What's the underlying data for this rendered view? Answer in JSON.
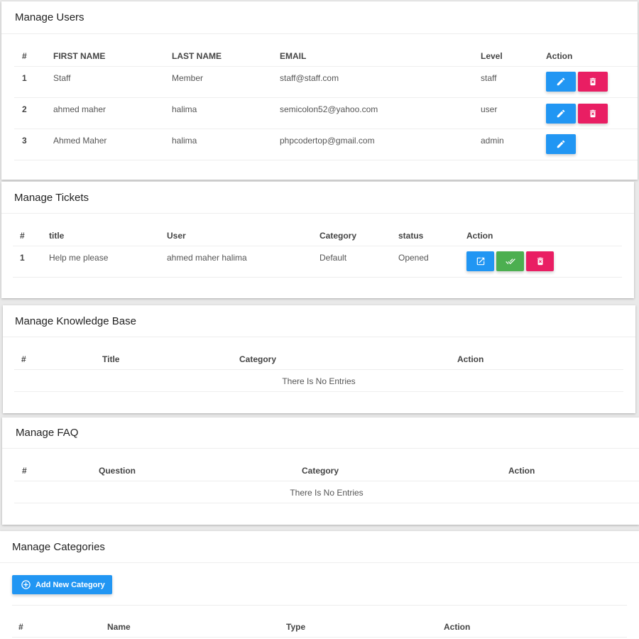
{
  "users": {
    "title": "Manage Users",
    "headers": [
      "#",
      "FIRST NAME",
      "LAST NAME",
      "EMAIL",
      "Level",
      "Action"
    ],
    "rows": [
      {
        "idx": "1",
        "first": "Staff",
        "last": "Member",
        "email": "staff@staff.com",
        "level": "staff"
      },
      {
        "idx": "2",
        "first": "ahmed maher",
        "last": "halima",
        "email": "semicolon52@yahoo.com",
        "level": "user"
      },
      {
        "idx": "3",
        "first": "Ahmed Maher",
        "last": "halima",
        "email": "phpcodertop@gmail.com",
        "level": "admin"
      }
    ]
  },
  "tickets": {
    "title": "Manage Tickets",
    "headers": [
      "#",
      "title",
      "User",
      "Category",
      "status",
      "Action"
    ],
    "rows": [
      {
        "idx": "1",
        "title": "Help me please",
        "user": "ahmed maher halima",
        "category": "Default",
        "status": "Opened"
      }
    ]
  },
  "kb": {
    "title": "Manage Knowledge Base",
    "headers": [
      "#",
      "Title",
      "Category",
      "Action"
    ],
    "empty": "There Is No Entries"
  },
  "faq": {
    "title": "Manage FAQ",
    "headers": [
      "#",
      "Question",
      "Category",
      "Action"
    ],
    "empty": "There Is No Entries"
  },
  "categories": {
    "title": "Manage Categories",
    "add_label": "Add New Category",
    "headers": [
      "#",
      "Name",
      "Type",
      "Action"
    ]
  },
  "icons": {
    "edit": "pencil-icon",
    "delete": "trash-icon",
    "open": "open-in-new-icon",
    "close": "double-check-icon",
    "add": "plus-circle-icon"
  },
  "colors": {
    "primary": "#2196f3",
    "danger": "#e91e63",
    "success": "#4caf50"
  }
}
